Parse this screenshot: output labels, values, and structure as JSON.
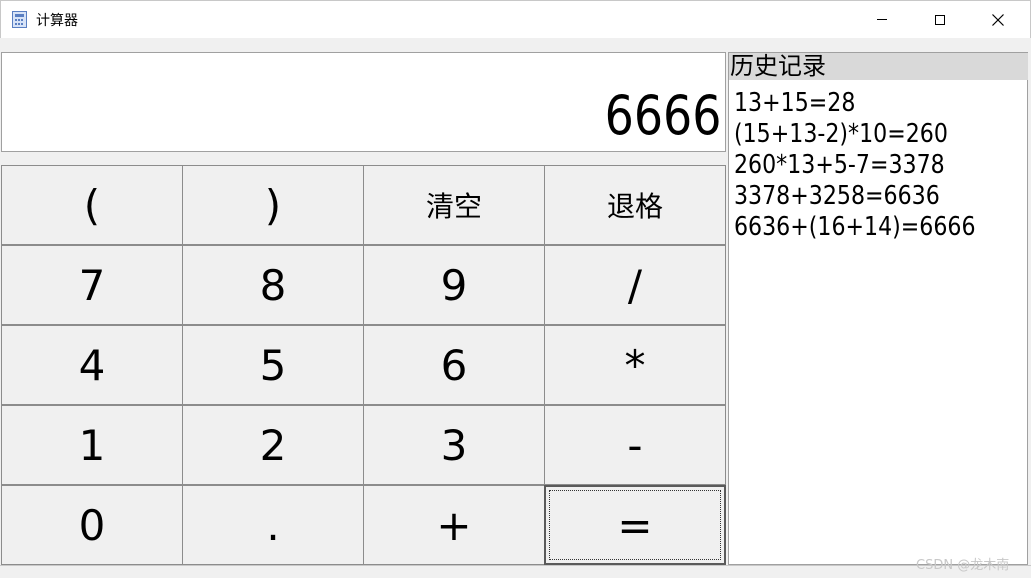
{
  "window": {
    "title": "计算器"
  },
  "display": {
    "value": "6666"
  },
  "keypad": {
    "rows": [
      [
        "(",
        ")",
        "清空",
        "退格"
      ],
      [
        "7",
        "8",
        "9",
        "/"
      ],
      [
        "4",
        "5",
        "6",
        "*"
      ],
      [
        "1",
        "2",
        "3",
        "-"
      ],
      [
        "0",
        ".",
        "+",
        "="
      ]
    ]
  },
  "history": {
    "header": "历史记录",
    "items": [
      "13+15=28",
      "(15+13-2)*10=260",
      "260*13+5-7=3378",
      "3378+3258=6636",
      "6636+(16+14)=6666"
    ]
  },
  "watermark": "CSDN @龙木南",
  "colors": {
    "window_bg": "#f0f0f0",
    "display_bg": "#ffffff",
    "history_header_bg": "#d9d9d9"
  }
}
